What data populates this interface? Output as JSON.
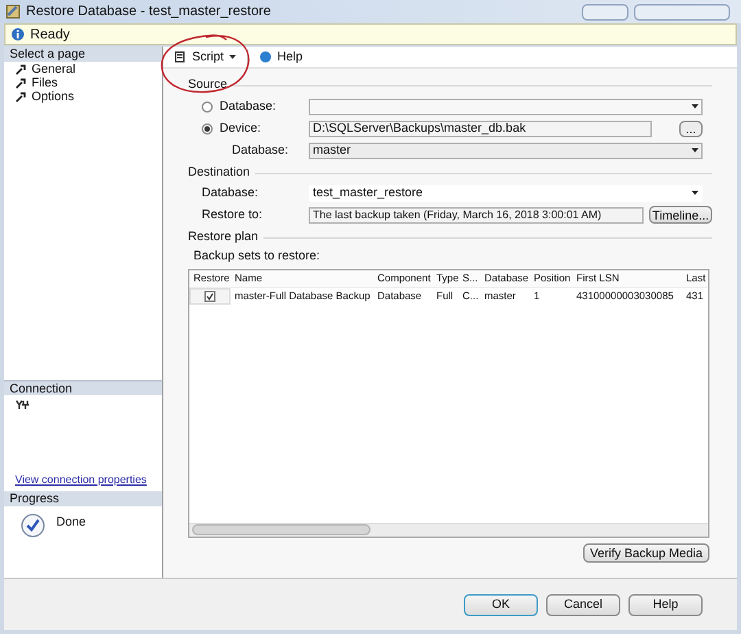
{
  "window": {
    "title": "Restore Database - test_master_restore"
  },
  "status": {
    "text": "Ready"
  },
  "sidebar": {
    "header": "Select a page",
    "items": [
      {
        "label": "General",
        "selected": false
      },
      {
        "label": "Files",
        "selected": false
      },
      {
        "label": "Options",
        "selected": false
      }
    ]
  },
  "connection": {
    "header": "Connection",
    "link": "View connection properties"
  },
  "progress": {
    "header": "Progress",
    "text": "Done"
  },
  "toolbar": {
    "script": "Script",
    "help": "Help"
  },
  "source": {
    "title": "Source",
    "database_label": "Database:",
    "database_selected": false,
    "device_label": "Device:",
    "device_selected": true,
    "device_path": "D:\\SQLServer\\Backups\\master_db.bak",
    "browse": "...",
    "device_db_label": "Database:",
    "device_db_value": "master"
  },
  "destination": {
    "title": "Destination",
    "database_label": "Database:",
    "database_value": "test_master_restore",
    "restore_to_label": "Restore to:",
    "restore_to_value": "The last backup taken (Friday, March 16, 2018 3:00:01 AM)",
    "timeline": "Timeline..."
  },
  "restore_plan": {
    "title": "Restore plan",
    "subtitle": "Backup sets to restore:",
    "table": {
      "columns": [
        "Restore",
        "Name",
        "Component",
        "Type",
        "S...",
        "Database",
        "Position",
        "First LSN",
        "Last"
      ],
      "rows": [
        {
          "checked": true,
          "cells": [
            "",
            "master-Full Database Backup",
            "Database",
            "Full",
            "C...",
            "master",
            "1",
            "43100000003030085",
            "431"
          ]
        }
      ]
    },
    "verify": "Verify Backup Media"
  },
  "buttons": [
    "OK",
    "Cancel",
    "Help"
  ],
  "annotation": {
    "kind": "circle"
  }
}
